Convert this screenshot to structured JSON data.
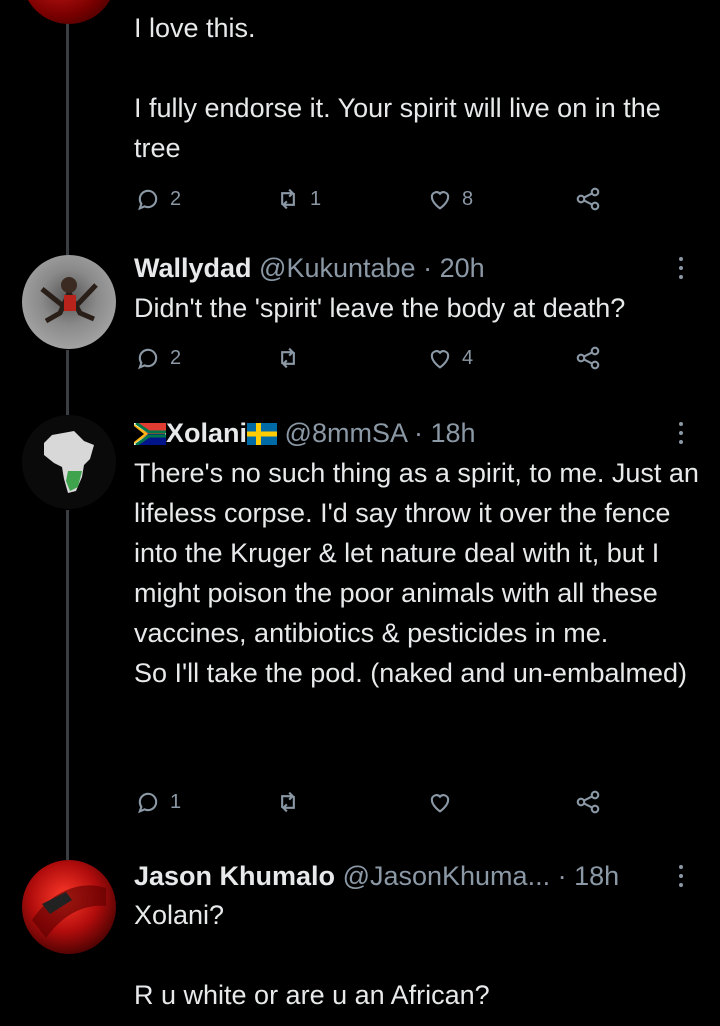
{
  "tweets": [
    {
      "text": "I love this.\n\nI fully endorse it. Your spirit will live on in the tree",
      "replies": "2",
      "retweets": "1",
      "likes": "8"
    },
    {
      "name": "Wallydad",
      "handle": "@Kukuntabe",
      "time": "· 20h",
      "text": "Didn't the 'spirit' leave the body at death?",
      "replies": "2",
      "retweets": "",
      "likes": "4"
    },
    {
      "name": "Xolani",
      "handle": "@8mmSA",
      "time": "· 18h",
      "text": "There's no such thing as a spirit, to me. Just an lifeless corpse. I'd say throw it over the fence into the Kruger & let nature deal with it, but I might poison the poor animals with all these vaccines, antibiotics & pesticides in me.\nSo I'll take the pod. (naked and un-embalmed)",
      "replies": "1",
      "retweets": "",
      "likes": ""
    },
    {
      "name": "Jason Khumalo",
      "handle": "@JasonKhuma...",
      "time": "· 18h",
      "text": "Xolani?\n\nR u white or are u an African?"
    }
  ],
  "icons": [
    "reply-icon",
    "retweet-icon",
    "like-icon",
    "share-icon",
    "more-icon"
  ],
  "colors": {
    "background": "#000000",
    "text": "#e7e9ea",
    "muted": "#8b98a5",
    "thread_line": "#3a3d41"
  }
}
